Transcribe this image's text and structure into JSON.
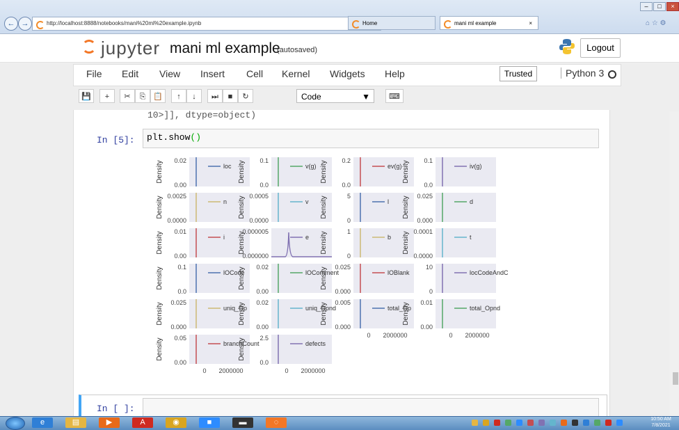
{
  "browser": {
    "url": "http://localhost:8888/notebooks/mani%20ml%20example.ipynb",
    "url_host_bold": "localhost",
    "search_hint": "⌕ ▾ ↻",
    "tabs": [
      {
        "label": "Home"
      },
      {
        "label": "mani ml example"
      }
    ],
    "tab_close": "×",
    "nav_back": "←",
    "nav_fwd": "→",
    "window_controls": [
      "–",
      "□",
      "×"
    ],
    "right_icons": "⌂ ☆ ⚙"
  },
  "jupyter": {
    "logo_text": "jupyter",
    "notebook_title": "mani ml example",
    "autosave": "(autosaved)",
    "logout": "Logout",
    "menu": [
      "File",
      "Edit",
      "View",
      "Insert",
      "Cell",
      "Kernel",
      "Widgets",
      "Help"
    ],
    "trusted": "Trusted",
    "kernel": "Python 3",
    "toolbar": [
      {
        "name": "save-icon",
        "glyph": "💾"
      },
      {
        "name": "insert-cell-icon",
        "glyph": "+"
      },
      {
        "name": "cut-icon",
        "glyph": "✂"
      },
      {
        "name": "copy-icon",
        "glyph": "⎘"
      },
      {
        "name": "paste-icon",
        "glyph": "📋"
      },
      {
        "name": "move-up-icon",
        "glyph": "↑"
      },
      {
        "name": "move-down-icon",
        "glyph": "↓"
      },
      {
        "name": "run-icon",
        "glyph": "⏭"
      },
      {
        "name": "interrupt-icon",
        "glyph": "■"
      },
      {
        "name": "restart-icon",
        "glyph": "↻"
      }
    ],
    "cell_type": "Code",
    "keyboard_icon": "⌨"
  },
  "cells": {
    "prev_output": "10>]], dtype=object)",
    "cell5_prompt": "In [5]:",
    "cell5_code_fn": "plt.show",
    "cell5_code_paren": "()",
    "cell6_prompt": "In [ ]:"
  },
  "chart_data": {
    "type": "line",
    "kind": "density grid",
    "colors": {
      "blue": "#4c72b0",
      "green": "#55a868",
      "red": "#c44e52",
      "purple": "#8172b2",
      "yellow": "#ccb974",
      "cyan": "#64b5cd"
    },
    "ylabel": "Density",
    "x_ticks": [
      "0",
      "2000000"
    ],
    "panels": [
      {
        "legend": "loc",
        "color": "blue",
        "yticks": [
          "0.02",
          "0.00"
        ],
        "show_ylabel": true,
        "shape": "spike"
      },
      {
        "legend": "v(g)",
        "color": "green",
        "yticks": [
          "0.1",
          "0.0"
        ],
        "show_ylabel": true,
        "shape": "spike"
      },
      {
        "legend": "ev(g)",
        "color": "red",
        "yticks": [
          "0.2",
          "0.0"
        ],
        "show_ylabel": true,
        "shape": "spike"
      },
      {
        "legend": "iv(g)",
        "color": "purple",
        "yticks": [
          "0.1",
          "0.0"
        ],
        "show_ylabel": true,
        "shape": "spike"
      },
      {
        "legend": "n",
        "color": "yellow",
        "yticks": [
          "0.0025",
          "0.0000"
        ],
        "show_ylabel": true,
        "shape": "spike"
      },
      {
        "legend": "v",
        "color": "cyan",
        "yticks": [
          "0.0005",
          "0.0000"
        ],
        "show_ylabel": true,
        "shape": "spike"
      },
      {
        "legend": "l",
        "color": "blue",
        "yticks": [
          "5",
          "0"
        ],
        "show_ylabel": true,
        "shape": "spike"
      },
      {
        "legend": "d",
        "color": "green",
        "yticks": [
          "0.025",
          "0.000"
        ],
        "show_ylabel": true,
        "shape": "spike"
      },
      {
        "legend": "i",
        "color": "red",
        "yticks": [
          "0.01",
          "0.00"
        ],
        "show_ylabel": true,
        "shape": "spike"
      },
      {
        "legend": "e",
        "color": "purple",
        "yticks": [
          "0.000005",
          "0.000000"
        ],
        "show_ylabel": true,
        "shape": "peak"
      },
      {
        "legend": "b",
        "color": "yellow",
        "yticks": [
          "1",
          "0"
        ],
        "show_ylabel": true,
        "shape": "spike"
      },
      {
        "legend": "t",
        "color": "cyan",
        "yticks": [
          "0.0001",
          "0.0000"
        ],
        "show_ylabel": true,
        "shape": "spike"
      },
      {
        "legend": "lOCode",
        "color": "blue",
        "yticks": [
          "0.1",
          "0.0"
        ],
        "show_ylabel": true,
        "shape": "spike"
      },
      {
        "legend": "lOComment",
        "color": "green",
        "yticks": [
          "0.02",
          "0.00"
        ],
        "show_ylabel": true,
        "shape": "spike"
      },
      {
        "legend": "lOBlank",
        "color": "red",
        "yticks": [
          "0.025",
          "0.000"
        ],
        "show_ylabel": true,
        "shape": "spike"
      },
      {
        "legend": "locCodeAndComment",
        "color": "purple",
        "yticks": [
          "10",
          "0"
        ],
        "show_ylabel": false,
        "shape": "spike"
      },
      {
        "legend": "uniq_Op",
        "color": "yellow",
        "yticks": [
          "0.025",
          "0.000"
        ],
        "show_ylabel": true,
        "shape": "spike"
      },
      {
        "legend": "uniq_Opnd",
        "color": "cyan",
        "yticks": [
          "0.02",
          "0.00"
        ],
        "show_ylabel": true,
        "shape": "spike"
      },
      {
        "legend": "total_Op",
        "color": "blue",
        "yticks": [
          "0.005",
          "0.000"
        ],
        "show_ylabel": true,
        "shape": "spike"
      },
      {
        "legend": "total_Opnd",
        "color": "green",
        "yticks": [
          "0.01",
          "0.00"
        ],
        "show_ylabel": true,
        "shape": "spike"
      },
      {
        "legend": "branchCount",
        "color": "red",
        "yticks": [
          "0.05",
          "0.00"
        ],
        "show_ylabel": true,
        "shape": "spike"
      },
      {
        "legend": "defects",
        "color": "purple",
        "yticks": [
          "2.5",
          "0.0"
        ],
        "show_ylabel": true,
        "shape": "spike"
      }
    ]
  },
  "taskbar": {
    "apps": [
      {
        "name": "ie-taskbar-icon",
        "glyph": "e",
        "color": "#2f7fd6"
      },
      {
        "name": "explorer-taskbar-icon",
        "glyph": "▤",
        "color": "#e5b643"
      },
      {
        "name": "media-player-taskbar-icon",
        "glyph": "▶",
        "color": "#e86a1a"
      },
      {
        "name": "acrobat-taskbar-icon",
        "glyph": "A",
        "color": "#cf2a20"
      },
      {
        "name": "chrome-taskbar-icon",
        "glyph": "◉",
        "color": "#d9a520"
      },
      {
        "name": "zoom-taskbar-icon",
        "glyph": "■",
        "color": "#2d8cff"
      },
      {
        "name": "terminal-taskbar-icon",
        "glyph": "▬",
        "color": "#333333"
      },
      {
        "name": "jupyter-taskbar-icon",
        "glyph": "◌",
        "color": "#f37726"
      }
    ],
    "time": "10:50 AM",
    "date": "7/8/2021"
  }
}
